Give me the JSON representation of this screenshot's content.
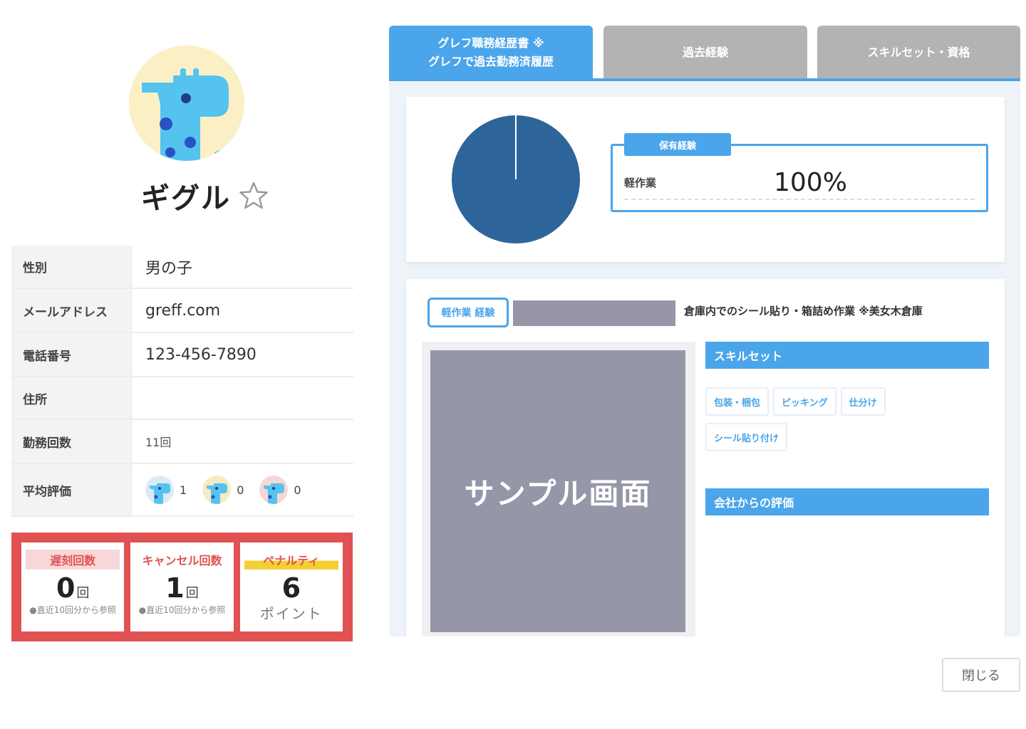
{
  "profile": {
    "name": "ギグル"
  },
  "info": {
    "rows": [
      {
        "label": "性別",
        "value": "男の子"
      },
      {
        "label": "メールアドレス",
        "value": "greff.com"
      },
      {
        "label": "電話番号",
        "value": "123-456-7890"
      },
      {
        "label": "住所",
        "value": ""
      },
      {
        "label": "勤務回数",
        "value": "11回"
      }
    ],
    "rating_label": "平均評価",
    "ratings": [
      {
        "count": "1",
        "color": "#dceaf6"
      },
      {
        "count": "0",
        "color": "#f6ecc2"
      },
      {
        "count": "0",
        "color": "#f6d6d6"
      }
    ]
  },
  "stats": {
    "late": {
      "label": "遅刻回数",
      "value": "0",
      "unit": "回",
      "note": "●直近10回分から参照"
    },
    "cancel": {
      "label": "キャンセル回数",
      "value": "1",
      "unit": "回",
      "note": "●直近10回分から参照"
    },
    "penalty": {
      "label": "ペナルティ",
      "value": "6",
      "sub": "ポイント"
    }
  },
  "tabs": [
    {
      "line1": "グレフ職務経歴書 ※",
      "line2": "グレフで過去勤務済履歴"
    },
    {
      "label": "過去経験"
    },
    {
      "label": "スキルセット・資格"
    }
  ],
  "experience": {
    "title": "保有経験",
    "item": "軽作業",
    "percent": "100%"
  },
  "chart_data": {
    "type": "pie",
    "categories": [
      "軽作業"
    ],
    "values": [
      100
    ],
    "colors": [
      "#2d6499"
    ]
  },
  "job": {
    "tag": "軽作業 経験",
    "title": "倉庫内でのシール貼り・箱詰め作業 ※美女木倉庫",
    "sample_text": "サンプル画面"
  },
  "skillset": {
    "title": "スキルセット",
    "items": [
      "包装・梱包",
      "ピッキング",
      "仕分け",
      "シール貼り付け"
    ]
  },
  "evaluation": {
    "title": "会社からの評価"
  },
  "close_label": "閉じる",
  "colors": {
    "accent": "#4aa5ea",
    "alert": "#e05252",
    "pie": "#2d6499",
    "inactive_tab": "#b3b3b3"
  }
}
